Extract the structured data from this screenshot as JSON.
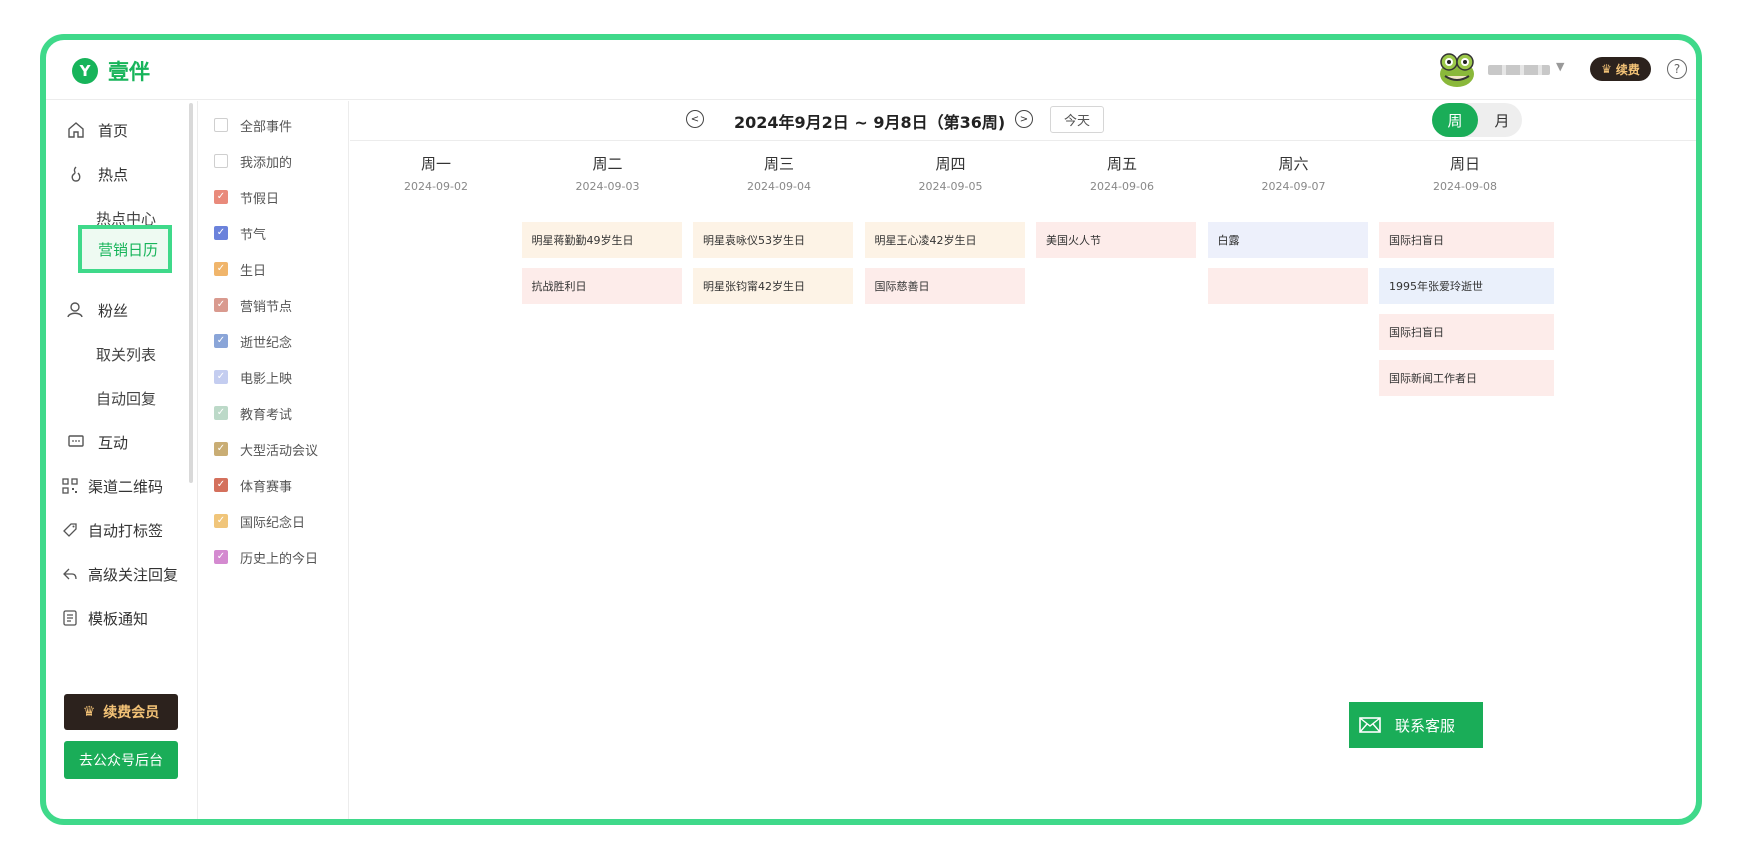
{
  "app": {
    "logo_glyph": "Y",
    "name": "壹伴",
    "vip_badge_label": "续费",
    "vip_icon": "crown-vip-icon",
    "help_glyph": "?"
  },
  "sidebar": {
    "items": [
      {
        "label": "首页",
        "icon": "home-icon"
      },
      {
        "label": "热点",
        "icon": "fire-icon"
      },
      {
        "label": "热点中心",
        "sub": true
      },
      {
        "label": "营销日历",
        "sub": true,
        "active": true
      },
      {
        "label": "粉丝",
        "icon": "user-icon"
      },
      {
        "label": "取关列表",
        "sub": true
      },
      {
        "label": "自动回复",
        "sub": true
      },
      {
        "label": "互动",
        "icon": "chat-icon"
      },
      {
        "label": "渠道二维码",
        "icon": "qrcode-icon"
      },
      {
        "label": "自动打标签",
        "icon": "tag-icon"
      },
      {
        "label": "高级关注回复",
        "icon": "reply-icon"
      },
      {
        "label": "模板通知",
        "icon": "template-icon"
      }
    ],
    "vip_button": "续费会员",
    "mp_button": "去公众号后台"
  },
  "filters": [
    {
      "label": "全部事件",
      "checked": false,
      "color": "#ffffff"
    },
    {
      "label": "我添加的",
      "checked": false,
      "color": "#ffffff"
    },
    {
      "label": "节假日",
      "checked": true,
      "color": "#e98a7b"
    },
    {
      "label": "节气",
      "checked": true,
      "color": "#6b82db"
    },
    {
      "label": "生日",
      "checked": true,
      "color": "#f0b56b"
    },
    {
      "label": "营销节点",
      "checked": true,
      "color": "#d99a8f"
    },
    {
      "label": "逝世纪念",
      "checked": true,
      "color": "#8aa5d8"
    },
    {
      "label": "电影上映",
      "checked": true,
      "color": "#c4cdf0"
    },
    {
      "label": "教育考试",
      "checked": true,
      "color": "#bcd9c8"
    },
    {
      "label": "大型活动会议",
      "checked": true,
      "color": "#c9ad74"
    },
    {
      "label": "体育赛事",
      "checked": true,
      "color": "#d4705c"
    },
    {
      "label": "国际纪念日",
      "checked": true,
      "color": "#f0c57a"
    },
    {
      "label": "历史上的今日",
      "checked": true,
      "color": "#d48ad0"
    }
  ],
  "calendar": {
    "week_title": "2024年9月2日 ~ 9月8日（第36周)",
    "today_label": "今天",
    "view_week": "周",
    "view_month": "月",
    "days": [
      {
        "name": "周一",
        "date": "2024-09-02",
        "events": []
      },
      {
        "name": "周二",
        "date": "2024-09-03",
        "events": [
          {
            "label": "明星蒋勤勤49岁生日",
            "bg": "#fdf3e6"
          },
          {
            "label": "抗战胜利日",
            "bg": "#fdecea"
          }
        ]
      },
      {
        "name": "周三",
        "date": "2024-09-04",
        "events": [
          {
            "label": "明星袁咏仪53岁生日",
            "bg": "#fdf3e6"
          },
          {
            "label": "明星张钧甯42岁生日",
            "bg": "#fdf3e6"
          }
        ]
      },
      {
        "name": "周四",
        "date": "2024-09-05",
        "events": [
          {
            "label": "明星王心凌42岁生日",
            "bg": "#fdf3e6"
          },
          {
            "label": "国际慈善日",
            "bg": "#fdecea"
          }
        ]
      },
      {
        "name": "周五",
        "date": "2024-09-06",
        "events": [
          {
            "label": "美国火人节",
            "bg": "#fdecea"
          }
        ]
      },
      {
        "name": "周六",
        "date": "2024-09-07",
        "events": [
          {
            "label": "白露",
            "bg": "#edf0fb"
          },
          {
            "label": "",
            "bg": "#fdecea"
          }
        ]
      },
      {
        "name": "周日",
        "date": "2024-09-08",
        "events": [
          {
            "label": "国际扫盲日",
            "bg": "#fdecea"
          },
          {
            "label": "1995年张爱玲逝世",
            "bg": "#eaf0fb"
          },
          {
            "label": "国际扫盲日",
            "bg": "#fdecea"
          },
          {
            "label": "国际新闻工作者日",
            "bg": "#fdecea"
          }
        ]
      }
    ]
  },
  "customer_service": {
    "label": "联系客服",
    "icon": "mail-icon"
  }
}
